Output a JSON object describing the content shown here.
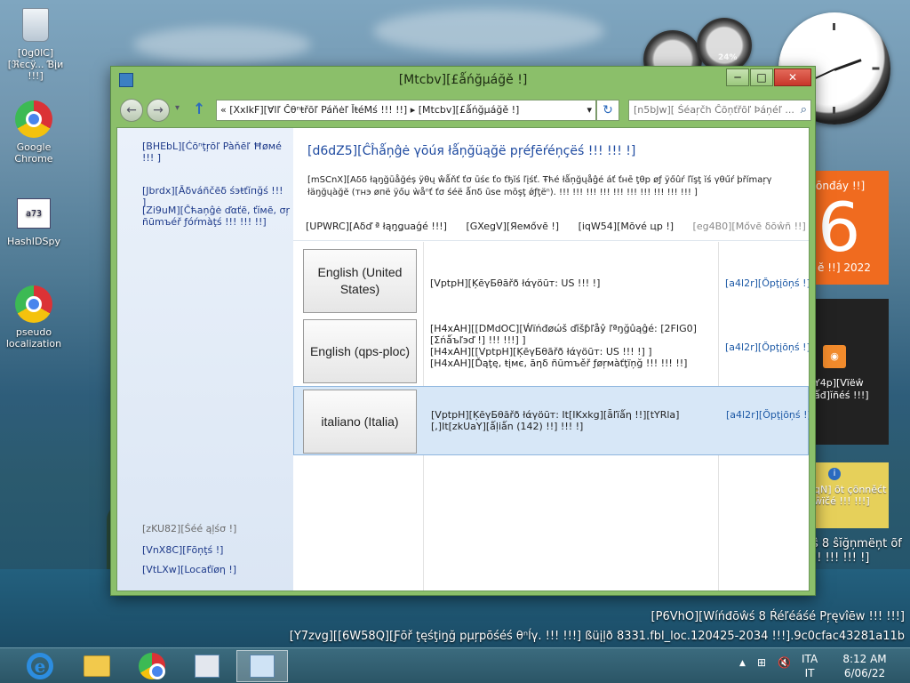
{
  "desktop": {
    "icons": [
      {
        "label": "[0g0lC][ℜєcÿ... Ɓįи !!!]"
      },
      {
        "label": "Google Chrome"
      },
      {
        "label": "HashIDSpy"
      },
      {
        "label": "pseudo localization"
      }
    ],
    "hashid_glyph": "a73",
    "meter_percent": "24%",
    "calendar": {
      "weekday": "ōnđáy !!]",
      "day": "6",
      "year": "ĕ !!] 2022"
    },
    "feed": {
      "rss_glyph": "◉",
      "text": "Y4p][Vïëŵ ǻđ]ĭñéś !!!]"
    },
    "network_gadget": {
      "info_glyph": "i",
      "text": "qN] ōt çōnněćt ŵïčé !!! !!!]"
    },
    "blurb": "ŝ 8 ŝĭğņmëņt õf !! !!! !!! !]",
    "watermark_line1": "[P6VhO][Wíńđōŵś 8 Ŕéľéáśé Pŗęvîēw !!! !!!]",
    "watermark_line2": "[Y7zvg][[6W58Q][Ƒōř ţęśţiŋğ pµŗpōśéś θⁿĺγ. !!! !!!] ßüįļð 8331.fbl_loc.120425-2034 !!!].9c0cfac43281a11b"
  },
  "window": {
    "title": "[Mtcbv][£ǻńğµáğě !]",
    "controls": {
      "minimize": "─",
      "maximize": "□",
      "close": "✕"
    },
    "nav": {
      "back": "←",
      "forward": "→",
      "up": "↑",
      "refresh": "↻",
      "history": "▾"
    },
    "address": {
      "chevron": "«",
      "crumb1": "[XxlkF][Ɐlľ Ĉθⁿŧřōľ Páňėľ ǏŧéMś !!! !!]",
      "sep": "▸",
      "crumb2": "[Mtcbv][£ǻńğµáğě !]",
      "dropdown": "▾"
    },
    "search": {
      "placeholder": "[n5bJw][ Śéaŗčh Ĉōņťřōľ Þáņéľ ...",
      "icon": "⌕"
    }
  },
  "sidebar": {
    "home": "[BHEbL][Ćōⁿţŗōľ Pàňēľ Ħøмé !!! ]",
    "advanced": "[Jbrdx][Āδváñčēδ śэŧťĭпğś !!! ]",
    "change_date": "[Zi9uM][Ĉћaņĝė ďαťē, ťĭмē, σŗ ñūmъéř ƒόŕmàţś !!! !!! !!]",
    "see_also": "[zKU82][Śéé ąļśσ !]",
    "fonts": "[VnX8C][Fōņţś !]",
    "location": "[VtLXw][Locaťïøη !]"
  },
  "main": {
    "heading": "[d6dZ5][Ĉĥǻņĝė γōúя łǻņğüąğë pŗéƒēŕéņçëś !!! !!! !]",
    "description": "[mSCnX][Aδδ łąŋğūåğéș ÿθų ŵǻňť ťσ ūśє ťo ťђĭś ľįśť. Ŧћé łǻņğųåĝé áť ťнē ţθp øƒ ÿőûŕ ľĭşţ ĭś γθűŕ þřímaŗγ łäŋğųàğĕ (тнэ øпë ÿőџ ẁåⁿť ťσ śéë ǻпδ ūse mōşţ ǿƒţёⁿ). !!! !!! !!! !!! !!! !!! !!! !!! !!! !!! ]",
    "toolbar": {
      "add": "[UPWRC][Aδď ª łąŋǥuaǵé !!!]",
      "remove": "[GXegV][Яeмővē !]",
      "move_up": "[iqW54][Mōvé цp !]",
      "move_down": "[eg4B0][Mővē δōŵñ !!]"
    },
    "languages": [
      {
        "name": "English (United States)",
        "details": "[VptpH][ĶēγБθāřð łάγöūт: US !!! !]",
        "options": "[a4l2r][Ŏpţįōņś !]"
      },
      {
        "name": "English (qps-ploc)",
        "details": "[H4xAH][[DMdOC][Ẃïńđøώš ďĭšƥľåŷ ľªŋğûąĝé: [2FIG0][Σńǻъľэď !] !!! !!!] ]\n[H4xAH][[VptpH][ĶēγБθāřð łάγöūт: US !!! !] ]\n[H4xAH][Ďąţę, ŧįмє, āηδ ñūmъěř ƒøŗмàťţïņğ !!! !!! !!]",
        "options": "[a4l2r][Ŏpţįōņś !]"
      },
      {
        "name": "italiano (Italia)",
        "details": "[VptpH][ĶēγБθāřð łάγöūт: It[IKxkg][ǟľïǻη !!][tYRla][,]It[zkUaY][ǻļiǻn (142) !!] !!! !]",
        "options": "[a4l2r][Ŏpţįōņś !]"
      }
    ]
  },
  "taskbar": {
    "ie_glyph": "e",
    "tray": {
      "chevron": "▲",
      "network": "⊞",
      "volume": "🔇"
    },
    "lang": "ITA",
    "lang2": "IT",
    "time": "8:12 AM",
    "date": "6/06/22"
  }
}
